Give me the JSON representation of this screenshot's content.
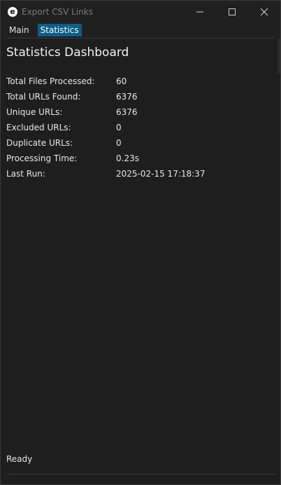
{
  "window": {
    "title": "Export CSV Links",
    "icon_letter": "e"
  },
  "tabs": [
    {
      "label": "Main",
      "active": false
    },
    {
      "label": "Statistics",
      "active": true
    }
  ],
  "dashboard": {
    "title": "Statistics Dashboard",
    "stats": [
      {
        "label": "Total Files Processed:",
        "value": "60"
      },
      {
        "label": "Total URLs Found:",
        "value": "6376"
      },
      {
        "label": "Unique URLs:",
        "value": "6376"
      },
      {
        "label": "Excluded URLs:",
        "value": "0"
      },
      {
        "label": "Duplicate URLs:",
        "value": "0"
      },
      {
        "label": "Processing Time:",
        "value": "0.23s"
      },
      {
        "label": "Last Run:",
        "value": "2025-02-15 17:18:37"
      }
    ]
  },
  "status": {
    "text": "Ready"
  },
  "colors": {
    "accent": "#0c5e86",
    "background": "#1e1e1e"
  },
  "icons": {
    "minimize": "minimize-icon",
    "maximize": "maximize-icon",
    "close": "close-icon"
  }
}
